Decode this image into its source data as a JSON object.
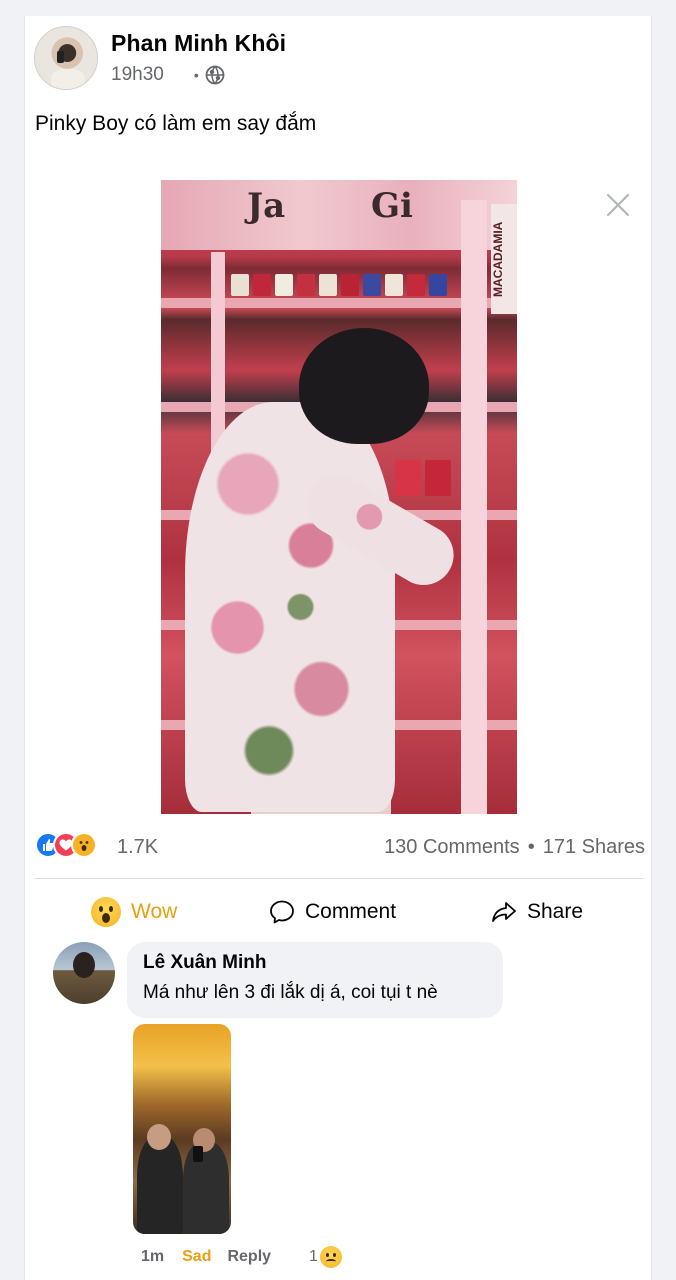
{
  "post": {
    "author": "Phan Minh Khôi",
    "time": "19h30",
    "separator": "•",
    "privacy_icon": "globe-icon",
    "text": "Pinky Boy có làm em say đắm",
    "photo_banner_text": [
      "Ja",
      "Gi"
    ],
    "photo_side_text": "MACADAMIA"
  },
  "stats": {
    "reaction_icons": [
      "like-icon",
      "love-icon",
      "wow-icon"
    ],
    "reaction_count": "1.7K",
    "comments": "130 Comments",
    "separator": "•",
    "shares": "171 Shares"
  },
  "actions": {
    "wow_label": "Wow",
    "comment_label": "Comment",
    "share_label": "Share"
  },
  "comment": {
    "author": "Lê Xuân Minh",
    "text": "Má như lên 3 đi lắk dị á, coi tụi t nè",
    "time": "1m",
    "reaction_label": "Sad",
    "reply_label": "Reply",
    "reaction_count": "1"
  },
  "colors": {
    "accent_wow": "#e6a012",
    "like_blue": "#1877f2",
    "love_red": "#f33e58",
    "muted_text": "#65676b"
  }
}
